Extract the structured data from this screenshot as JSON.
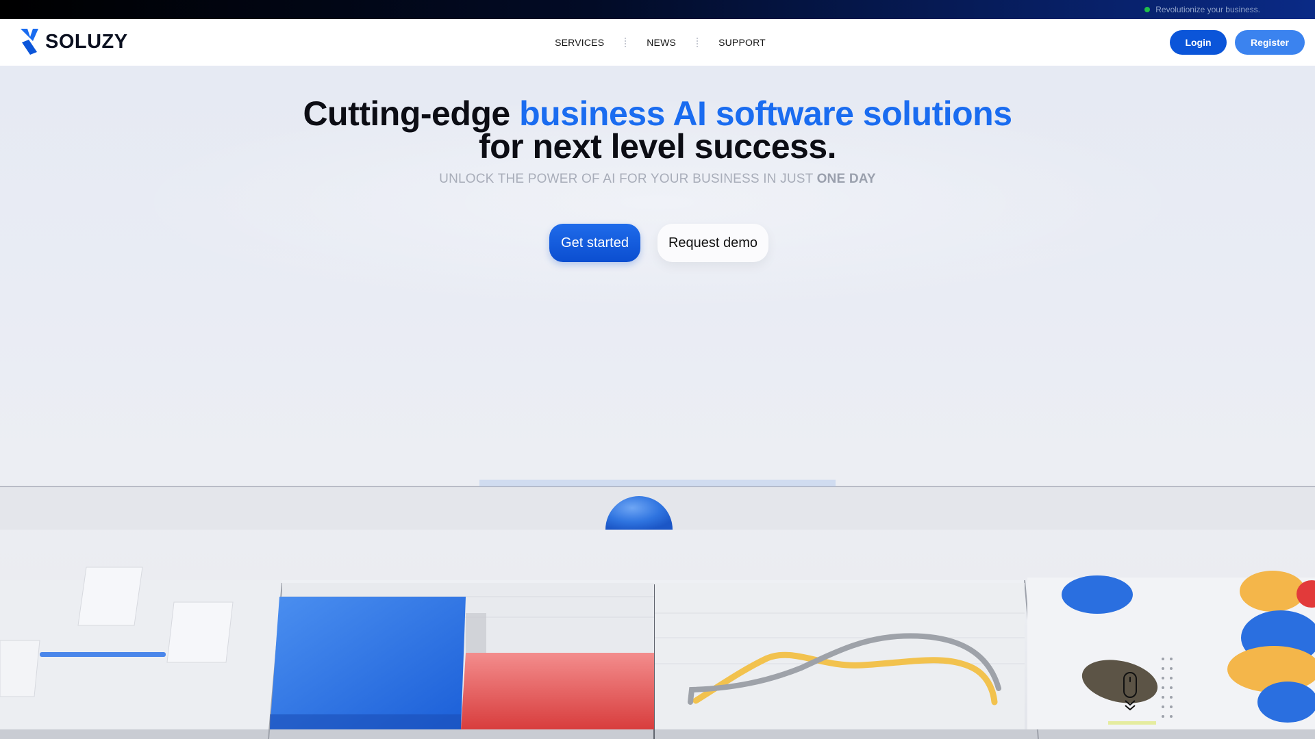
{
  "announcement": {
    "text": "Revolutionize your business."
  },
  "brand": {
    "name": "SOLUZY",
    "colors": {
      "primary": "#0b55d9",
      "accent": "#1a6cf0",
      "secondary": "#3b83ef"
    }
  },
  "nav": {
    "items": [
      "SERVICES",
      "NEWS",
      "SUPPORT"
    ]
  },
  "auth": {
    "login_label": "Login",
    "register_label": "Register"
  },
  "hero": {
    "headline_part1": "Cutting-edge ",
    "headline_accent": "business AI software solutions",
    "headline_part2": "for next level success.",
    "subline_prefix": "UNLOCK THE POWER OF AI FOR YOUR BUSINESS IN JUST ",
    "subline_emphasis": "ONE DAY",
    "cta_primary": "Get started",
    "cta_secondary": "Request demo"
  },
  "icons": {
    "logo": "soluzy-logo-icon",
    "scroll": "mouse-scroll-icon"
  }
}
